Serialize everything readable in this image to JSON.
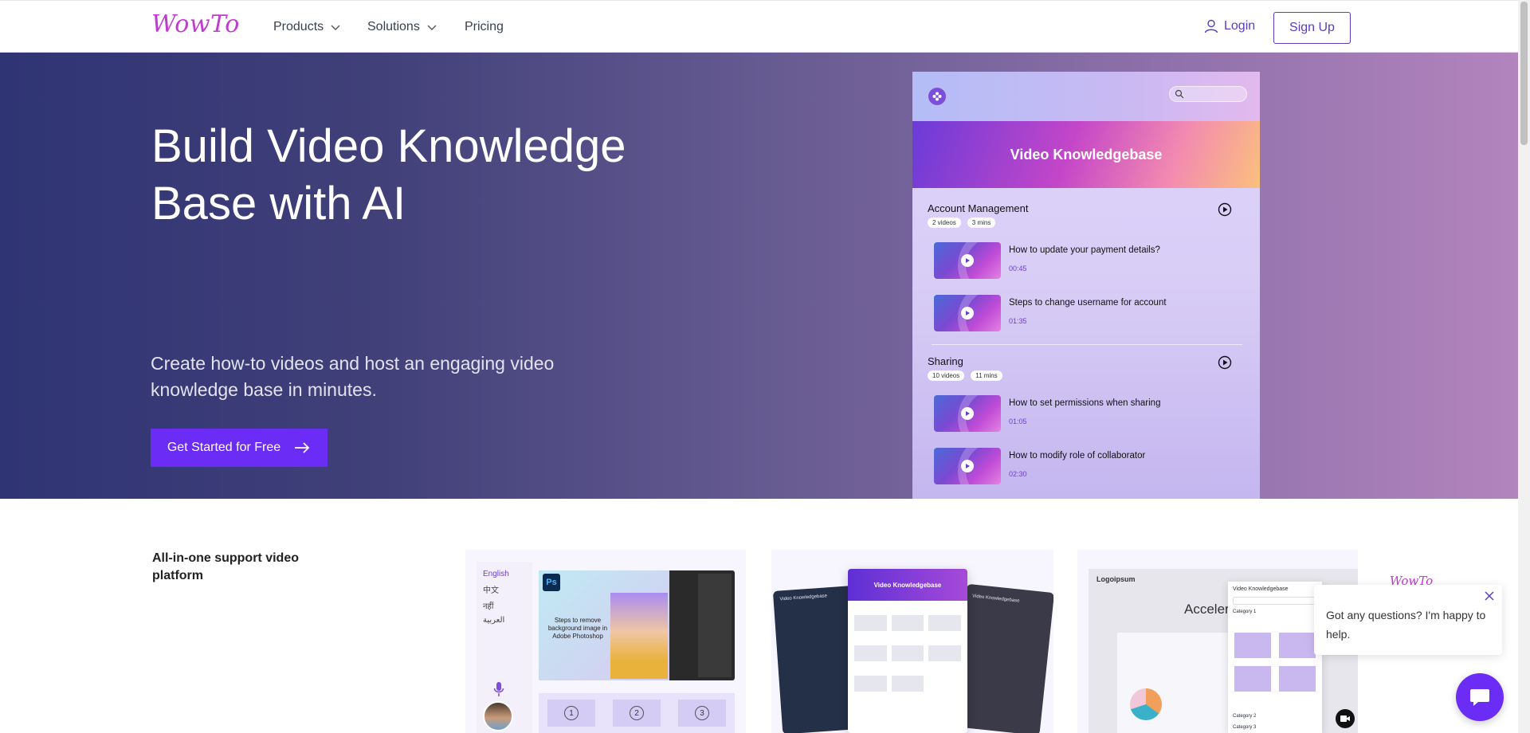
{
  "nav": {
    "logo": "WowTo",
    "products": "Products",
    "solutions": "Solutions",
    "pricing": "Pricing",
    "login": "Login",
    "signup": "Sign Up"
  },
  "hero": {
    "title": "Build Video Knowledge Base with AI",
    "subtitle": "Create how-to videos and host an engaging video knowledge base in minutes.",
    "cta": "Get Started for Free"
  },
  "kb_preview": {
    "banner": "Video Knowledgebase",
    "categories": [
      {
        "title": "Account Management",
        "videos_chip": "2 videos",
        "time_chip": "3 mins",
        "videos": [
          {
            "title": "How to update your payment details?",
            "time": "00:45"
          },
          {
            "title": "Steps to change username for account",
            "time": "01:35"
          }
        ]
      },
      {
        "title": "Sharing",
        "videos_chip": "10 videos",
        "time_chip": "11 mins",
        "videos": [
          {
            "title": "How to set permissions when sharing",
            "time": "01:05"
          },
          {
            "title": "How to modify role of collaborator",
            "time": "02:30"
          }
        ]
      }
    ]
  },
  "section": {
    "tagline": "All-in-one support video platform",
    "card1": {
      "languages": [
        "English",
        "中文",
        "नहीं",
        "العربية"
      ],
      "ps_label": "Ps",
      "ps_caption": "Steps to remove background image in Adobe Photoshop",
      "steps": [
        "1",
        "2",
        "3"
      ]
    },
    "card2": {
      "header": "Video Knowledgebase",
      "dark_left_label": "Video Knowledgebase",
      "dark_right_label": "Video Knowledgebase"
    },
    "card3": {
      "logo": "Logoipsum",
      "headline": "Accelera developer",
      "kb_title": "Video Knowledgebase",
      "category1": "Category 1",
      "category2": "Category 2",
      "category3": "Category 3"
    }
  },
  "chat": {
    "logo": "WowTo",
    "message": "Got any questions? I'm happy to help."
  },
  "colors": {
    "accent": "#6b2cf5",
    "brand_pink": "#c13ad1",
    "link_purple": "#5b3cc4"
  }
}
